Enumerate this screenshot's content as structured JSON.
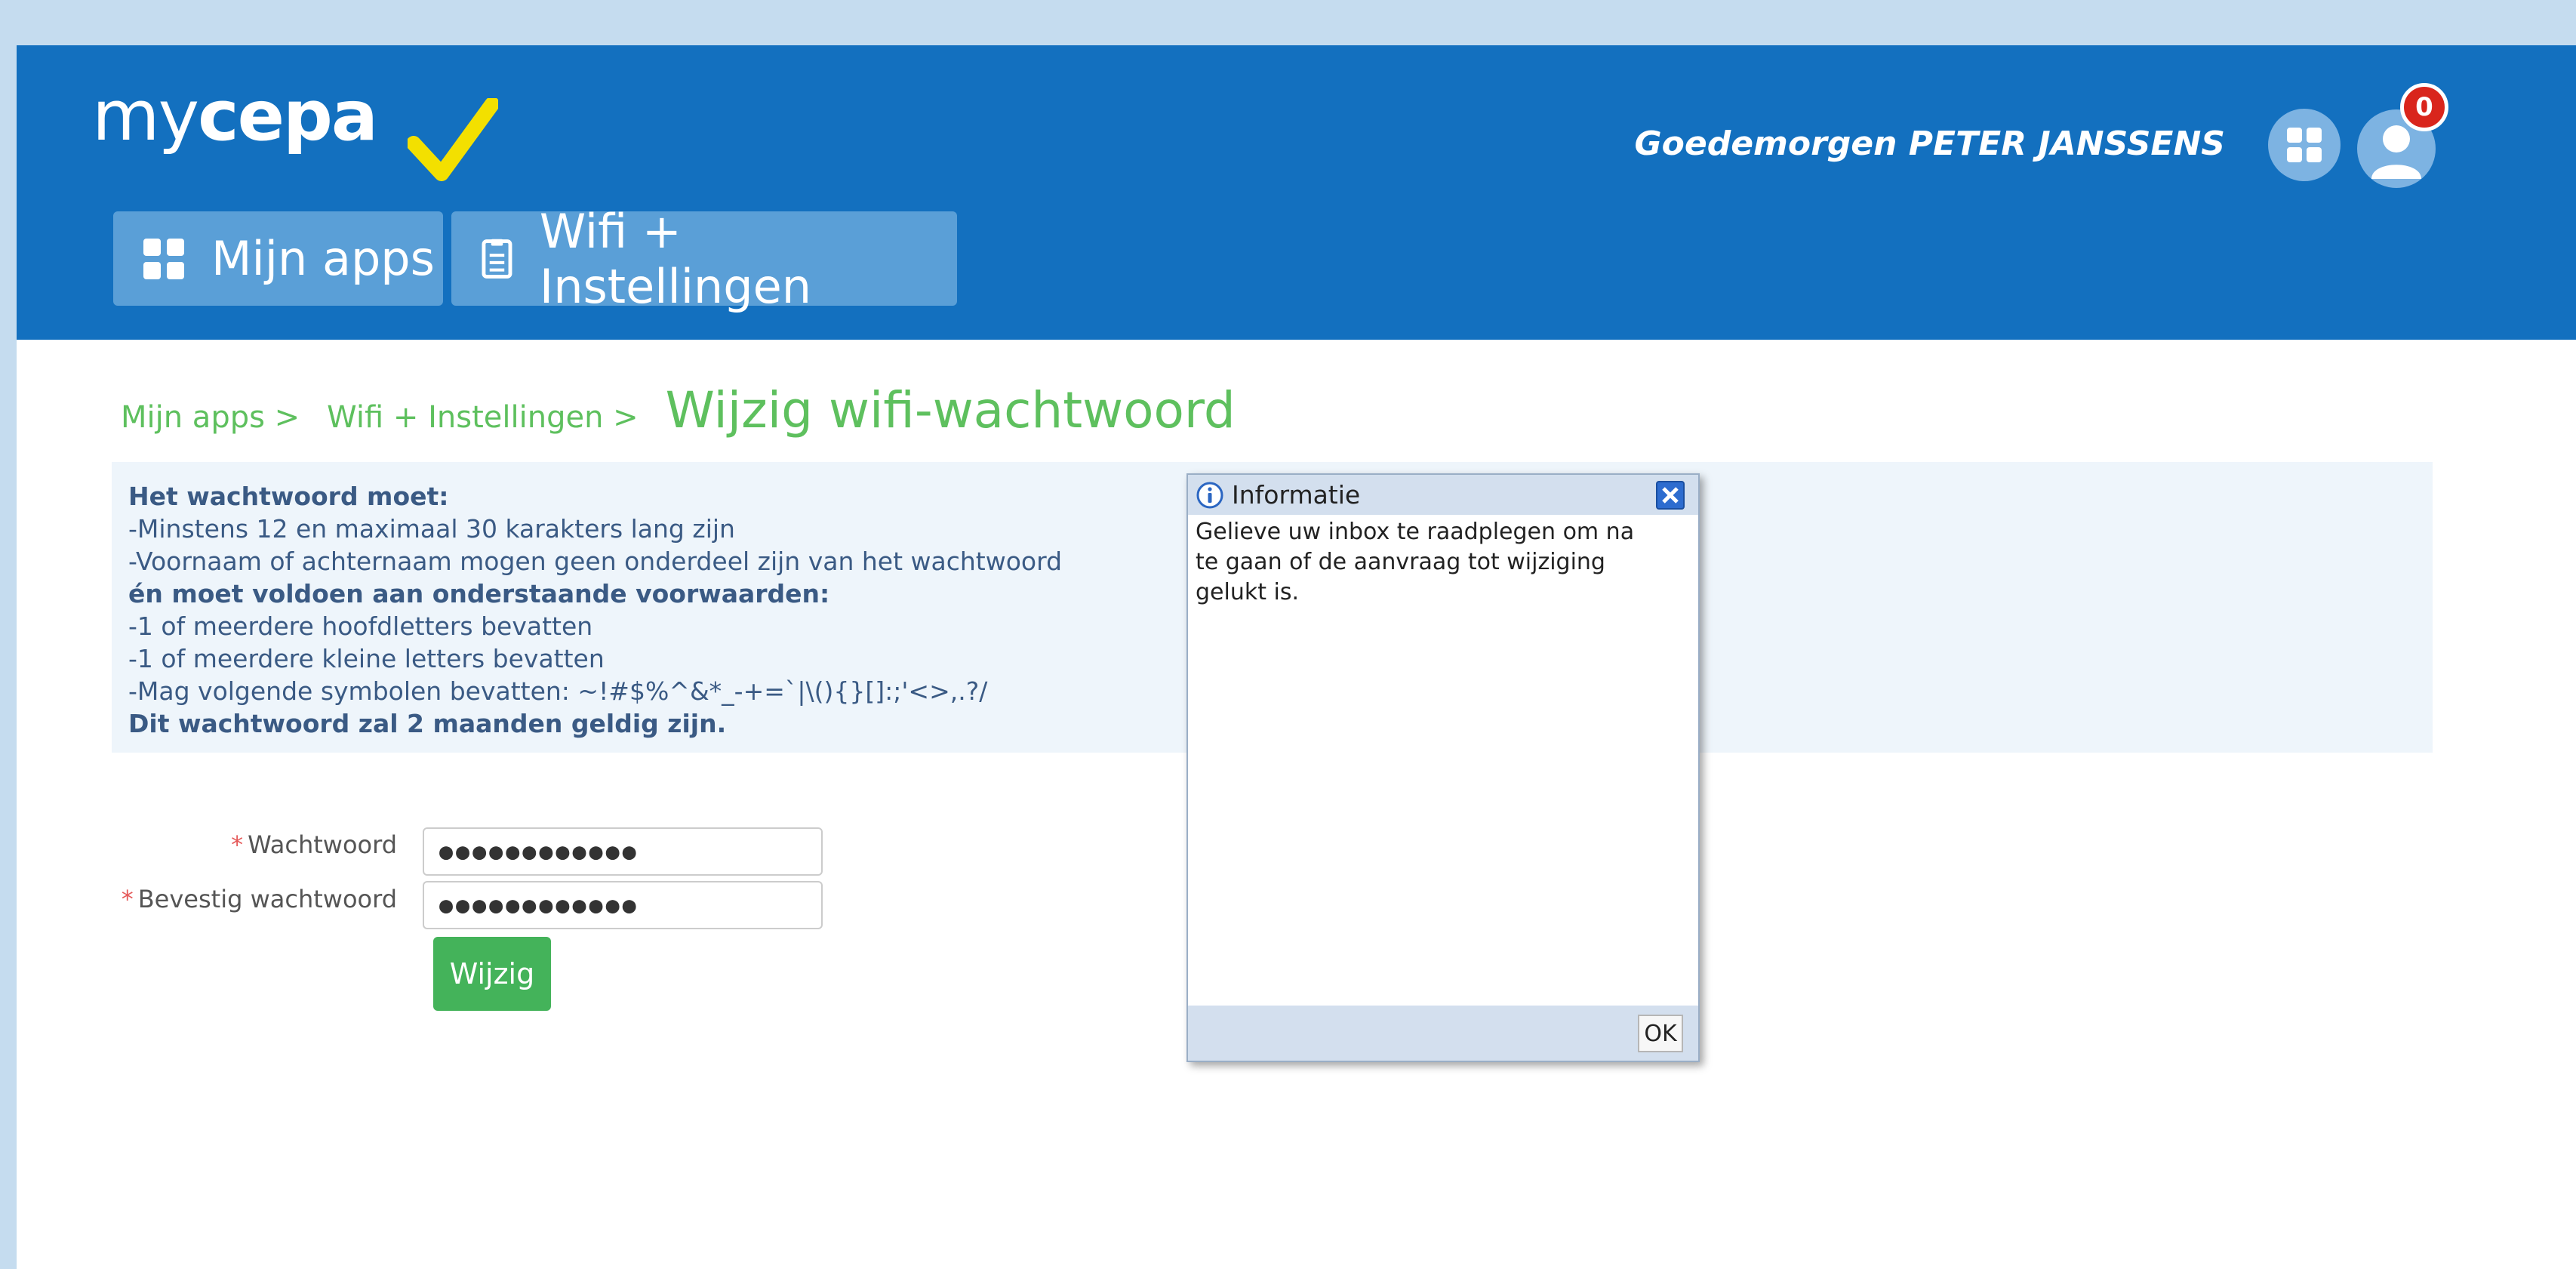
{
  "header": {
    "logo_light": "my",
    "logo_bold": "cepa",
    "greeting": "Goedemorgen PETER JANSSENS",
    "notification_count": "0",
    "nav": {
      "apps_label": "Mijn apps",
      "wifi_label": "Wifi + Instellingen"
    }
  },
  "breadcrumb": {
    "items": [
      "Mijn apps >",
      "Wifi + Instellingen >"
    ],
    "current": "Wijzig wifi-wachtwoord"
  },
  "requirements": {
    "heading": "Het wachtwoord moet:",
    "rule1": "-Minstens 12 en maximaal 30 karakters lang zijn",
    "rule2": "-Voornaam of achternaam mogen geen onderdeel zijn van het wachtwoord",
    "subheading": "én moet voldoen aan onderstaande voorwaarden:",
    "rule3": "-1 of meerdere hoofdletters bevatten",
    "rule4": "-1 of meerdere kleine letters bevatten",
    "rule5": "-Mag volgende symbolen bevatten: ~!#$%^&*_-+=`|\\(){}[]:;'<>,.?/",
    "footer": "Dit wachtwoord zal 2 maanden geldig zijn."
  },
  "form": {
    "password_label": "Wachtwoord",
    "password_value": "●●●●●●●●●●●●",
    "confirm_label": "Bevestig wachtwoord",
    "confirm_value": "●●●●●●●●●●●●",
    "submit_label": "Wijzig",
    "required_marker": "*"
  },
  "dialog": {
    "title": "Informatie",
    "message": "Gelieve uw inbox te raadplegen om na te gaan of de aanvraag tot wijziging gelukt is.",
    "ok_label": "OK"
  },
  "colors": {
    "header_bg": "#1370bf",
    "nav_button_bg": "#5a9fd7",
    "accent_green": "#5ec05e",
    "submit_green": "#44b35a",
    "info_bg": "#eef5fb",
    "info_text": "#3a5a84",
    "check_yellow": "#f3e000"
  }
}
